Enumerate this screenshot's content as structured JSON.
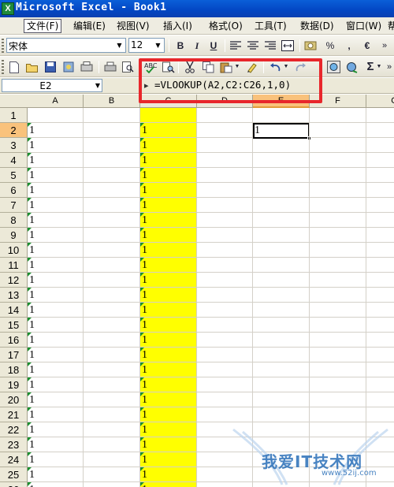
{
  "window": {
    "title": "Microsoft Excel - Book1",
    "app_icon": "excel-x-icon"
  },
  "menu": {
    "items": [
      "文件(F)",
      "编辑(E)",
      "视图(V)",
      "插入(I)",
      "格式(O)",
      "工具(T)",
      "数据(D)",
      "窗口(W)",
      "帮"
    ]
  },
  "format_toolbar": {
    "font_name": "宋体",
    "font_size": "12",
    "bold": "B",
    "italic": "I",
    "underline": "U",
    "percent": "%",
    "comma": ",",
    "euro": "€",
    "more": "»"
  },
  "formula_bar": {
    "name_box": "E2",
    "fx": "fx",
    "formula": "=VLOOKUP(A2,C2:C26,1,0)"
  },
  "sheet": {
    "columns": [
      "A",
      "B",
      "C",
      "D",
      "E",
      "F",
      "G"
    ],
    "active_column": "E",
    "active_row": "2",
    "rows": [
      "1",
      "2",
      "3",
      "4",
      "5",
      "6",
      "7",
      "8",
      "9",
      "10",
      "11",
      "12",
      "13",
      "14",
      "15",
      "16",
      "17",
      "18",
      "19",
      "20",
      "21",
      "22",
      "23",
      "24",
      "25",
      "26"
    ],
    "column_a_values": [
      "",
      "1",
      "1",
      "1",
      "1",
      "1",
      "1",
      "1",
      "1",
      "1",
      "1",
      "1",
      "1",
      "1",
      "1",
      "1",
      "1",
      "1",
      "1",
      "1",
      "1",
      "1",
      "1",
      "1",
      "1",
      "1"
    ],
    "column_c_values": [
      "",
      "1",
      "1",
      "1",
      "1",
      "1",
      "1",
      "1",
      "1",
      "1",
      "1",
      "1",
      "1",
      "1",
      "1",
      "1",
      "1",
      "1",
      "1",
      "1",
      "1",
      "1",
      "1",
      "1",
      "1",
      "1"
    ],
    "e2_value": "1",
    "highlight_fill": "#ffff00",
    "error_indicator_color": "#1a8f2e"
  },
  "annotation": {
    "box_color": "#e8262b"
  },
  "watermark": {
    "text": "我爱IT技术网",
    "url": "www.52ij.com"
  }
}
